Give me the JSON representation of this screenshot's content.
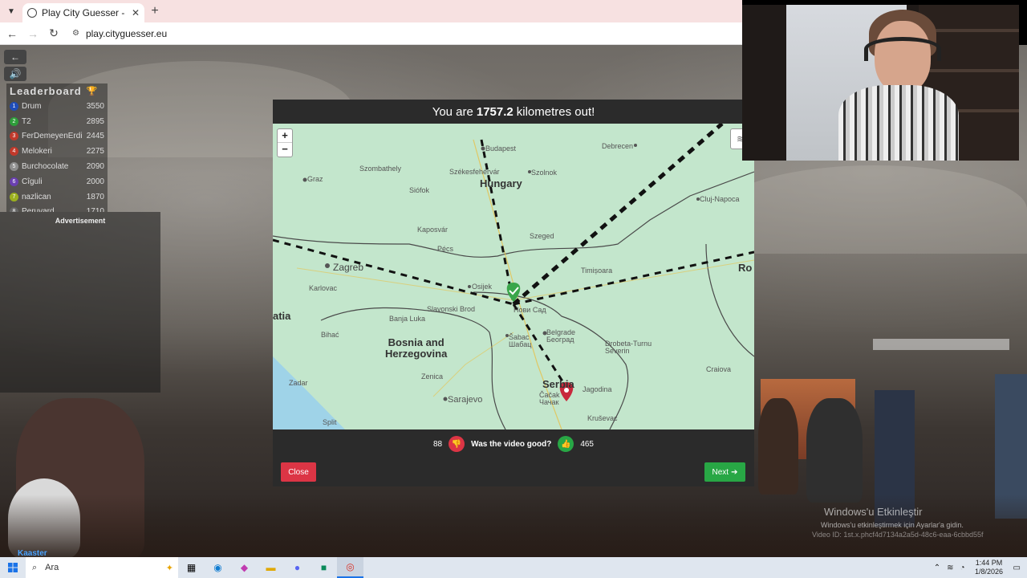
{
  "browser": {
    "tab_title": "Play City Guesser - Explore the W",
    "url": "play.cityguesser.eu",
    "new_tab": "+",
    "tab_close": "✕"
  },
  "leaderboard": {
    "title": "Leaderboard",
    "entries": [
      {
        "rank": "1",
        "name": "Drum",
        "score": "3550",
        "color": "#1f4db8"
      },
      {
        "rank": "2",
        "name": "T2",
        "score": "2895",
        "color": "#2e9d3a"
      },
      {
        "rank": "3",
        "name": "FerDemeyenErdi",
        "score": "2445",
        "color": "#c0392b"
      },
      {
        "rank": "4",
        "name": "Melokeri",
        "score": "2275",
        "color": "#c0392b"
      },
      {
        "rank": "5",
        "name": "Burchocolate",
        "score": "2090",
        "color": "#8e8e8e"
      },
      {
        "rank": "6",
        "name": "Cîguli",
        "score": "2000",
        "color": "#6a3fb0"
      },
      {
        "rank": "7",
        "name": "nazlican",
        "score": "1870",
        "color": "#9bb01f"
      },
      {
        "rank": "8",
        "name": "Peruvard",
        "score": "1710",
        "color": "#666"
      }
    ],
    "advertisement": "Advertisement"
  },
  "result": {
    "prefix": "You are",
    "distance": "1757.2",
    "suffix": "kilometres out!",
    "close_x": "×",
    "zoom_in": "+",
    "zoom_out": "−",
    "map_labels": {
      "hungary": "Hungary",
      "bosnia": "Bosnia and\nHerzegovina",
      "serbia": "Serbia",
      "budapest": "Budapest",
      "debrecen": "Debrecen",
      "szolnok": "Szolnok",
      "szombathely": "Szombathely",
      "szekesfehervar": "Székesfehérvár",
      "graz": "Graz",
      "siofok": "Siófok",
      "kaposvar": "Kaposvár",
      "szeged": "Szeged",
      "pecs": "Pécs",
      "zagreb": "Zagreb",
      "karlovac": "Karlovac",
      "timisoara": "Timișoara",
      "osijek": "Osijek",
      "novi_sad": "Нови Сад",
      "slavonski": "Slavonski Brod",
      "bihac": "Bihać",
      "banja_luka": "Banja Luka",
      "belgrade": "Belgrade\nБеоград",
      "sabac": "Šabac\nШабац",
      "zenica": "Zenica",
      "zadar": "Zadar",
      "sarajevo": "Sarajevo",
      "split": "Split",
      "cacak": "Čačak\nЧачак",
      "jagodina": "Jagodina",
      "krusevac": "Kruševac",
      "drobeta": "Drobeta-Turnu\nSeverin",
      "craiova": "Craiova",
      "cluj": "Cluj-Napoca",
      "ro": "Ro",
      "atia": "atia"
    },
    "vote": {
      "down_count": "88",
      "question": "Was the video good?",
      "up_count": "465"
    },
    "close_label": "Close",
    "next_label": "Next"
  },
  "overlay": {
    "watermark_title": "Windows'u Etkinleştir",
    "watermark_sub": "Windows'u etkinleştirmek için Ayarlar'a gidin.",
    "video_id": "Video ID: 1st.x.phcf4d7134a2a5d-48c6-eaa-6cbbd55f"
  },
  "streamer_tag": "Kaaster",
  "taskbar": {
    "search_placeholder": "Ara",
    "time": "1:44 PM",
    "date": "1/8/2026"
  },
  "colors": {
    "close_red": "#dc3545",
    "next_green": "#28a745",
    "route_black": "#111111",
    "guess_marker": "#3aa64a",
    "actual_marker": "#c8283c"
  }
}
